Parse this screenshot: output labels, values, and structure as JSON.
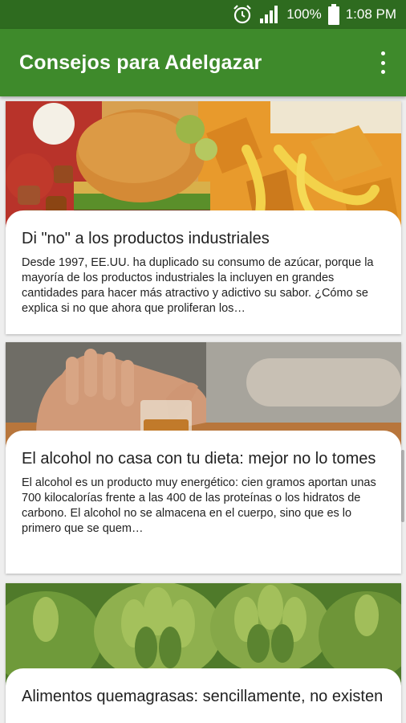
{
  "status_bar": {
    "battery_percent": "100%",
    "time": "1:08 PM",
    "icons": [
      "alarm-icon",
      "signal-icon",
      "battery-icon"
    ]
  },
  "app_bar": {
    "title": "Consejos para Adelgazar",
    "menu_icon": "more-vert-icon"
  },
  "colors": {
    "status_bar": "#2e6b1f",
    "app_bar": "#3e8a2b",
    "background": "#eeeeee"
  },
  "articles": [
    {
      "title": "Di \"no\" a los productos industriales",
      "excerpt": "Desde 1997, EE.UU. ha duplicado su consumo de azúcar, porque la mayoría de los productos industriales la incluyen en grandes cantidades para hacer más atractivo y adictivo su sabor. ¿Cómo se explica si no que ahora que proliferan los…"
    },
    {
      "title": "El alcohol no casa con tu dieta: mejor no lo tomes",
      "excerpt": "El alcohol es un producto muy energético: cien gramos aportan unas 700 kilocalorías frente a las 400 de las proteínas o los hidratos de carbono. El alcohol no se almacena en el cuerpo, sino que es lo primero que se quem…"
    },
    {
      "title": "Alimentos quemagrasas: sencillamente, no existen",
      "excerpt": ""
    }
  ]
}
